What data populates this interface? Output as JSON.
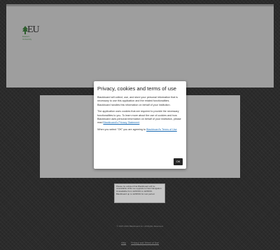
{
  "logo": {
    "text": "EU",
    "subtitle": "Eastern University"
  },
  "dialog": {
    "title": "Privacy, cookies and terms of use",
    "paragraph1": "Blackboard will collect, use, and store your personal information that is necessary to use this application and the related functionalities. Blackboard handles this information on behalf of your institution.",
    "paragraph2_text": "The application uses cookies that are required to provide the necessary functionalities to you. To learn more about the use of cookies and how Blackboard uses personal information on behalf of your institution, please read ",
    "paragraph2_link": "Blackboard's Privacy Statement",
    "paragraph3_text": "When you select \"OK\" you are agreeing to ",
    "paragraph3_link": "Blackboard's Terms of Use",
    "ok_label": "OK"
  },
  "notice": {
    "text": "Please be advised that Blackboard will be unavailable while we upgrade to New Navigation. Unavailable from 12/23/19 to 12/28/19. Blackboard up to 12/28/19 for rest period."
  },
  "footer": {
    "copyright": "© 1997-2019 Blackboard Inc. All Rights Reserved.",
    "links": [
      "Help",
      "Privacy and Terms of Use"
    ]
  },
  "colors": {
    "background": "#2b2b2b",
    "panel": "#9e9e9e",
    "link": "#1a6bb3",
    "button": "#262626"
  }
}
